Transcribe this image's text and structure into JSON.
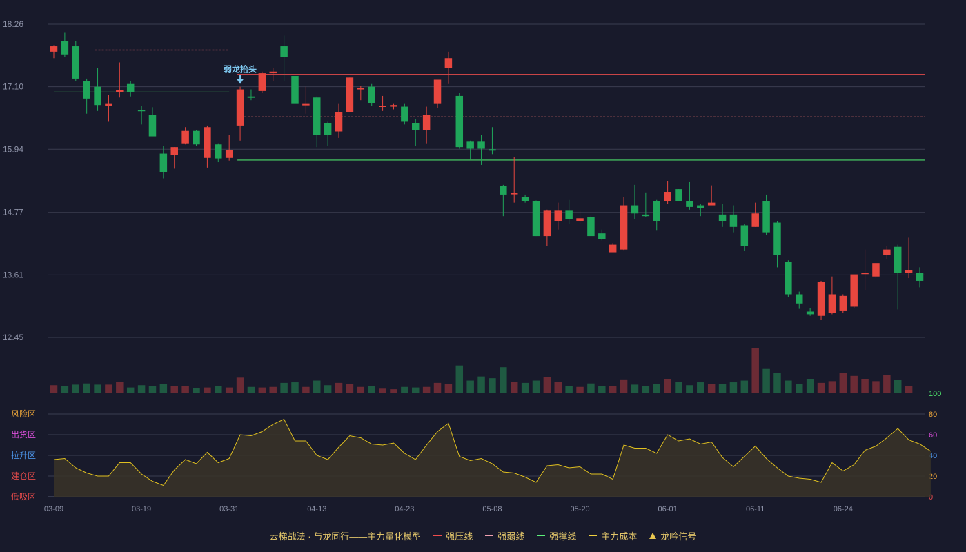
{
  "chart_data": {
    "type": "candlestick",
    "price_axis": {
      "ticks": [
        "18.26",
        "17.10",
        "15.94",
        "14.77",
        "13.61",
        "12.45"
      ],
      "min": 12.45,
      "max": 18.26
    },
    "x_ticks": [
      {
        "i": 0,
        "label": "03-09"
      },
      {
        "i": 8,
        "label": "03-19"
      },
      {
        "i": 16,
        "label": "03-31"
      },
      {
        "i": 24,
        "label": "04-13"
      },
      {
        "i": 32,
        "label": "04-23"
      },
      {
        "i": 40,
        "label": "05-08"
      },
      {
        "i": 48,
        "label": "05-20"
      },
      {
        "i": 56,
        "label": "06-01"
      },
      {
        "i": 64,
        "label": "06-11"
      },
      {
        "i": 72,
        "label": "06-24"
      }
    ],
    "ohlc": [
      [
        17.75,
        17.85,
        17.63,
        17.87
      ],
      [
        17.95,
        17.7,
        17.65,
        18.1
      ],
      [
        17.85,
        17.25,
        17.2,
        17.95
      ],
      [
        17.2,
        16.88,
        16.6,
        17.25
      ],
      [
        17.1,
        16.76,
        16.65,
        17.45
      ],
      [
        16.75,
        16.78,
        16.45,
        16.95
      ],
      [
        17.0,
        17.04,
        16.9,
        17.55
      ],
      [
        17.15,
        17.0,
        16.92,
        17.2
      ],
      [
        16.67,
        16.65,
        16.4,
        16.75
      ],
      [
        16.58,
        16.18,
        16.18,
        16.72
      ],
      [
        15.86,
        15.52,
        15.4,
        16.0
      ],
      [
        15.83,
        15.98,
        15.58,
        15.98
      ],
      [
        16.05,
        16.28,
        16.03,
        16.35
      ],
      [
        16.28,
        16.03,
        16.0,
        16.3
      ],
      [
        15.78,
        16.35,
        15.6,
        16.38
      ],
      [
        16.03,
        15.77,
        15.7,
        16.05
      ],
      [
        15.78,
        15.93,
        15.73,
        16.2
      ],
      [
        16.38,
        17.05,
        16.1,
        17.1
      ],
      [
        16.92,
        16.9,
        16.85,
        17.05
      ],
      [
        17.02,
        17.35,
        16.98,
        17.38
      ],
      [
        17.35,
        17.38,
        17.2,
        17.45
      ],
      [
        17.85,
        17.65,
        17.2,
        18.05
      ],
      [
        17.3,
        16.78,
        16.72,
        17.35
      ],
      [
        16.78,
        16.78,
        16.6,
        17.1
      ],
      [
        16.9,
        16.2,
        15.98,
        16.92
      ],
      [
        16.43,
        16.2,
        16.0,
        16.45
      ],
      [
        16.27,
        16.63,
        16.15,
        16.78
      ],
      [
        16.63,
        17.27,
        16.63,
        17.27
      ],
      [
        17.05,
        17.08,
        16.85,
        17.12
      ],
      [
        17.1,
        16.8,
        16.75,
        17.15
      ],
      [
        16.73,
        16.75,
        16.65,
        16.93
      ],
      [
        16.73,
        16.76,
        16.68,
        16.78
      ],
      [
        16.73,
        16.45,
        16.4,
        16.78
      ],
      [
        16.43,
        16.3,
        16.0,
        16.5
      ],
      [
        16.3,
        16.58,
        16.05,
        16.73
      ],
      [
        16.78,
        17.23,
        16.7,
        17.23
      ],
      [
        17.45,
        17.63,
        17.15,
        17.75
      ],
      [
        16.93,
        15.98,
        15.95,
        16.98
      ],
      [
        16.08,
        15.95,
        15.75,
        16.1
      ],
      [
        16.08,
        15.95,
        15.65,
        16.2
      ],
      [
        15.94,
        15.93,
        15.85,
        16.35
      ],
      [
        15.26,
        15.1,
        14.7,
        15.28
      ],
      [
        15.11,
        15.13,
        14.95,
        15.8
      ],
      [
        15.05,
        14.98,
        14.95,
        15.1
      ],
      [
        14.98,
        14.33,
        14.33,
        14.99
      ],
      [
        14.33,
        14.8,
        14.15,
        14.82
      ],
      [
        14.6,
        14.8,
        14.45,
        14.95
      ],
      [
        14.8,
        14.65,
        14.55,
        15.0
      ],
      [
        14.6,
        14.66,
        14.55,
        14.8
      ],
      [
        14.68,
        14.33,
        14.33,
        14.71
      ],
      [
        14.38,
        14.28,
        14.25,
        14.45
      ],
      [
        14.03,
        14.17,
        14.03,
        14.2
      ],
      [
        14.08,
        14.9,
        14.06,
        15.05
      ],
      [
        14.9,
        14.75,
        14.65,
        15.28
      ],
      [
        14.73,
        14.7,
        14.68,
        15.14
      ],
      [
        14.98,
        14.6,
        14.43,
        15.0
      ],
      [
        14.98,
        15.15,
        14.92,
        15.35
      ],
      [
        15.2,
        14.98,
        14.98,
        15.2
      ],
      [
        14.98,
        14.87,
        14.82,
        15.33
      ],
      [
        14.9,
        14.85,
        14.7,
        14.92
      ],
      [
        14.9,
        14.95,
        14.93,
        15.27
      ],
      [
        14.73,
        14.6,
        14.5,
        14.92
      ],
      [
        14.73,
        14.5,
        14.4,
        14.9
      ],
      [
        14.53,
        14.15,
        14.05,
        14.55
      ],
      [
        14.5,
        14.75,
        14.5,
        14.95
      ],
      [
        14.98,
        14.4,
        14.35,
        15.1
      ],
      [
        14.58,
        13.98,
        13.75,
        14.6
      ],
      [
        13.85,
        13.25,
        13.2,
        13.88
      ],
      [
        13.25,
        13.08,
        12.98,
        13.3
      ],
      [
        12.93,
        12.88,
        12.85,
        13.0
      ],
      [
        12.85,
        13.48,
        12.77,
        13.5
      ],
      [
        12.9,
        13.25,
        12.88,
        13.58
      ],
      [
        12.95,
        13.22,
        12.9,
        13.25
      ],
      [
        13.02,
        13.62,
        13.0,
        13.62
      ],
      [
        13.63,
        13.65,
        13.32,
        14.08
      ],
      [
        13.58,
        13.83,
        13.55,
        13.83
      ],
      [
        13.98,
        14.08,
        13.9,
        14.15
      ],
      [
        14.13,
        13.65,
        12.97,
        14.17
      ],
      [
        13.65,
        13.7,
        13.55,
        14.3
      ],
      [
        13.65,
        13.5,
        13.38,
        13.75
      ]
    ],
    "volume": [
      0.14,
      0.13,
      0.15,
      0.17,
      0.15,
      0.15,
      0.2,
      0.1,
      0.14,
      0.12,
      0.16,
      0.13,
      0.12,
      0.09,
      0.1,
      0.12,
      0.1,
      0.27,
      0.11,
      0.1,
      0.11,
      0.18,
      0.19,
      0.11,
      0.22,
      0.14,
      0.18,
      0.16,
      0.11,
      0.12,
      0.08,
      0.07,
      0.11,
      0.1,
      0.11,
      0.18,
      0.16,
      0.48,
      0.22,
      0.29,
      0.26,
      0.45,
      0.2,
      0.18,
      0.22,
      0.28,
      0.2,
      0.12,
      0.11,
      0.17,
      0.13,
      0.13,
      0.24,
      0.15,
      0.13,
      0.16,
      0.25,
      0.2,
      0.14,
      0.19,
      0.16,
      0.16,
      0.19,
      0.22,
      0.78,
      0.42,
      0.35,
      0.22,
      0.16,
      0.25,
      0.18,
      0.21,
      0.35,
      0.3,
      0.25,
      0.21,
      0.31,
      0.23,
      0.13
    ],
    "oscillator": {
      "labels": [
        {
          "text": "风险区",
          "value": 80,
          "color": "#e8a33a"
        },
        {
          "text": "出货区",
          "value": 60,
          "color": "#d94fd9"
        },
        {
          "text": "拉升区",
          "value": 40,
          "color": "#4a90e2"
        },
        {
          "text": "建仓区",
          "value": 20,
          "color": "#e24a4a"
        },
        {
          "text": "低吸区",
          "value": 0,
          "color": "#e24a4a"
        }
      ],
      "ticks": [
        "100",
        "80",
        "60",
        "40",
        "20",
        "0"
      ],
      "values": [
        36,
        37,
        28,
        23,
        20,
        20,
        33,
        33,
        22,
        15,
        11,
        26,
        36,
        32,
        43,
        33,
        37,
        60,
        59,
        63,
        70,
        75,
        54,
        54,
        40,
        36,
        48,
        59,
        57,
        51,
        50,
        52,
        42,
        36,
        50,
        63,
        71,
        39,
        35,
        37,
        32,
        24,
        23,
        19,
        14,
        30,
        31,
        28,
        29,
        22,
        22,
        17,
        50,
        47,
        47,
        42,
        60,
        54,
        56,
        51,
        53,
        38,
        29,
        39,
        49,
        37,
        28,
        20,
        18,
        17,
        14,
        33,
        25,
        31,
        45,
        49,
        57,
        66,
        55,
        51,
        44
      ]
    },
    "hlines": [
      {
        "name": "strong_pressure_1",
        "y": 17.78,
        "x0": 4,
        "x1": 16,
        "style": "dash",
        "color": "#f07070"
      },
      {
        "name": "support_1",
        "y": 17.0,
        "x0": 0,
        "x1": 16,
        "style": "solid",
        "color": "#4cdc6a"
      },
      {
        "name": "strong_pressure_2",
        "y": 17.33,
        "x0": 17,
        "x1": 81,
        "style": "solid",
        "color": "#e24a4a"
      },
      {
        "name": "weak_line",
        "y": 16.54,
        "x0": 17,
        "x1": 81,
        "style": "dash",
        "color": "#f07070"
      },
      {
        "name": "support_2",
        "y": 15.74,
        "x0": 17,
        "x1": 81,
        "style": "solid",
        "color": "#4cdc6a"
      }
    ],
    "annotation": {
      "text": "弱龙抬头",
      "i": 17
    },
    "legend": [
      {
        "label": "云梯战法 · 与龙同行——主力量化模型",
        "style": "text",
        "color": "#e0c46a"
      },
      {
        "label": "强压线",
        "style": "solid",
        "color": "#f04d4d"
      },
      {
        "label": "强弱线",
        "style": "dash",
        "color": "#f0a0b0"
      },
      {
        "label": "强撑线",
        "style": "solid",
        "color": "#5cef7a"
      },
      {
        "label": "主力成本",
        "style": "dash",
        "color": "#f0d040"
      },
      {
        "label": "龙吟信号",
        "style": "tri",
        "color": "#e8c650"
      }
    ],
    "colors": {
      "up": "#e8473f",
      "down": "#1fa65a",
      "vol_up": "#6b2b35",
      "vol_down": "#1f5a42",
      "grid": "#3a3d50",
      "osc_line": "#e0c020",
      "osc_fill": "#3a3428",
      "annot": "#7ec8f0",
      "axis_text": "#8e93a8"
    }
  }
}
